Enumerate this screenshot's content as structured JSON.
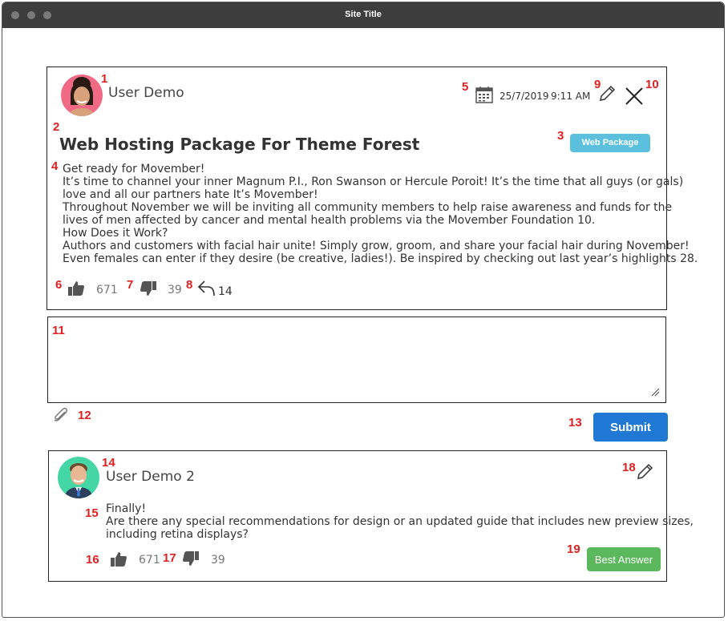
{
  "window": {
    "title": "Site Title"
  },
  "post": {
    "number": "1",
    "username": "User Demo",
    "date": "25/7/2019",
    "time": "9:11 AM",
    "title": "Web Hosting Package For Theme Forest",
    "tag": "Web Package",
    "body_lines": [
      "Get ready for Movember!",
      "It’s time to channel your inner Magnum P.I., Ron Swanson or Hercule Poroit! It’s the time that all guys (or gals)",
      "love and all our partners hate It’s Movember!",
      "Throughout November we will be inviting all community members to help raise awareness and funds for the",
      "lives of men affected by cancer and mental health problems via the Movember Foundation 10.",
      "How Does it Work?",
      "Authors and customers with facial hair unite! Simply grow, groom, and share your facial hair during November!",
      "Even females can enter if they desire (be creative, ladies!). Be inspired by checking out last year’s highlights 28."
    ],
    "likes": "671",
    "dislikes": "39",
    "replies": "14"
  },
  "comment": {
    "value": "",
    "placeholder": ""
  },
  "submit_label": "Submit",
  "reply": {
    "username": "User Demo 2",
    "body_lines": [
      "Finally!",
      "Are there any special recommendations for design or an updated guide that includes new preview sizes,",
      "including retina displays?"
    ],
    "likes": "671",
    "dislikes": "39",
    "best_answer_label": "Best Answer"
  },
  "markers": [
    "1",
    "2",
    "3",
    "4",
    "5",
    "6",
    "7",
    "8",
    "9",
    "10",
    "11",
    "12",
    "13",
    "14",
    "15",
    "16",
    "17",
    "18",
    "19"
  ],
  "colors": {
    "marker": "#e02020",
    "tag": "#5bc0de",
    "submit": "#1e78d4",
    "best_answer": "#5cb85c",
    "avatar1_bg": "#f06a86",
    "avatar2_bg": "#44d6a4"
  },
  "icons": [
    "calendar-icon",
    "edit-icon",
    "close-icon",
    "thumbs-up-icon",
    "thumbs-down-icon",
    "reply-icon",
    "paperclip-icon",
    "resize-grip-icon"
  ]
}
